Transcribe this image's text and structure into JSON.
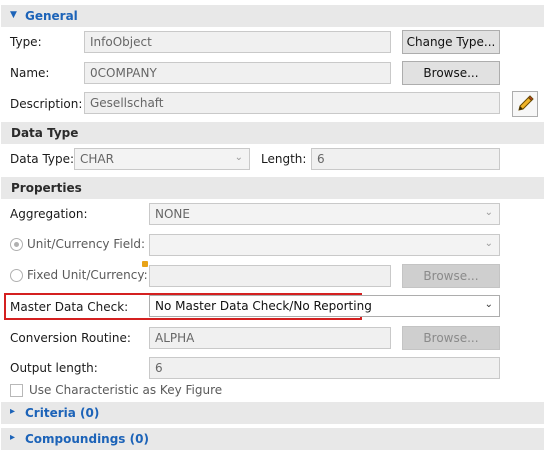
{
  "general": {
    "title": "General",
    "type_label": "Type:",
    "type_value": "InfoObject",
    "change_type_label": "Change Type...",
    "name_label": "Name:",
    "name_value": "0COMPANY",
    "browse_label": "Browse...",
    "description_label": "Description:",
    "description_value": "Gesellschaft",
    "edit_icon": "pencil-icon"
  },
  "data_type": {
    "title": "Data Type",
    "data_type_label": "Data Type:",
    "data_type_value": "CHAR",
    "length_label": "Length:",
    "length_value": "6"
  },
  "properties": {
    "title": "Properties",
    "aggregation_label": "Aggregation:",
    "aggregation_value": "NONE",
    "unit_currency_label": "Unit/Currency Field:",
    "unit_currency_value": "",
    "fixed_unit_label": "Fixed Unit/Currency:",
    "fixed_unit_value": "",
    "fixed_browse_label": "Browse...",
    "master_data_check_label": "Master Data Check:",
    "master_data_check_value": "No Master Data Check/No Reporting",
    "conversion_routine_label": "Conversion Routine:",
    "conversion_routine_value": "ALPHA",
    "conversion_browse_label": "Browse...",
    "output_length_label": "Output length:",
    "output_length_value": "6",
    "key_figure_label": "Use Characteristic as Key Figure"
  },
  "criteria": {
    "title": "Criteria (0)"
  },
  "compoundings": {
    "title": "Compoundings (0)"
  },
  "colors": {
    "section_title": "#1c63b8",
    "highlight": "#d42020"
  }
}
